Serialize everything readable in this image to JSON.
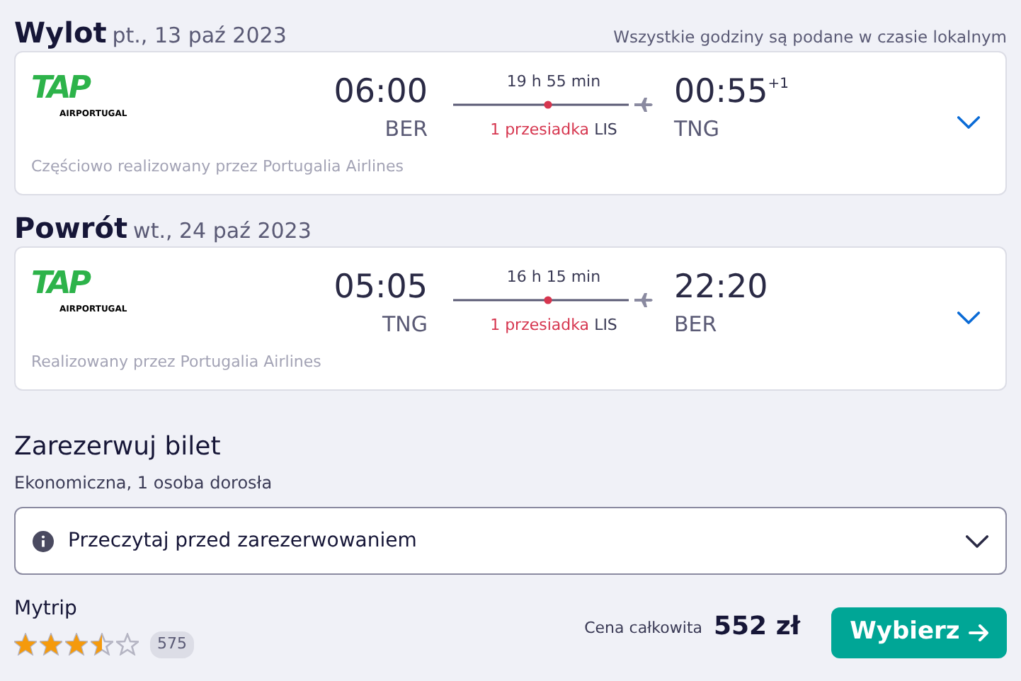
{
  "notice": "Wszystkie godziny są podane w czasie lokalnym",
  "legs": [
    {
      "title": "Wylot",
      "date": "pt., 13 paź 2023",
      "logo_text": "TAP",
      "logo_subtext": "AIRPORTUGAL",
      "depart_time": "06:00",
      "depart_airport": "BER",
      "duration": "19 h 55 min",
      "stops": "1 przesiadka",
      "stop_airport": "LIS",
      "arrive_time": "00:55",
      "day_offset": "+1",
      "arrive_airport": "TNG",
      "operator": "Częściowo realizowany przez Portugalia Airlines",
      "expanded": false
    },
    {
      "title": "Powrót",
      "date": "wt., 24 paź 2023",
      "logo_text": "TAP",
      "logo_subtext": "AIRPORTUGAL",
      "depart_time": "05:05",
      "depart_airport": "TNG",
      "duration": "16 h 15 min",
      "stops": "1 przesiadka",
      "stop_airport": "LIS",
      "arrive_time": "22:20",
      "arrive_airport": "BER",
      "operator": "Realizowany przez Portugalia Airlines",
      "expanded": false
    }
  ],
  "booking": {
    "title": "Zarezerwuj bilet",
    "subtitle": "Ekonomiczna, 1 osoba dorosła",
    "info": {
      "label": "Przeczytaj przed zarezerwowaniem",
      "expanded": false
    },
    "provider": "Mytrip",
    "stars": 3.5,
    "review_count": "575",
    "price_label": "Cena całkowita",
    "price": "552 zł",
    "button": "Wybierz"
  }
}
